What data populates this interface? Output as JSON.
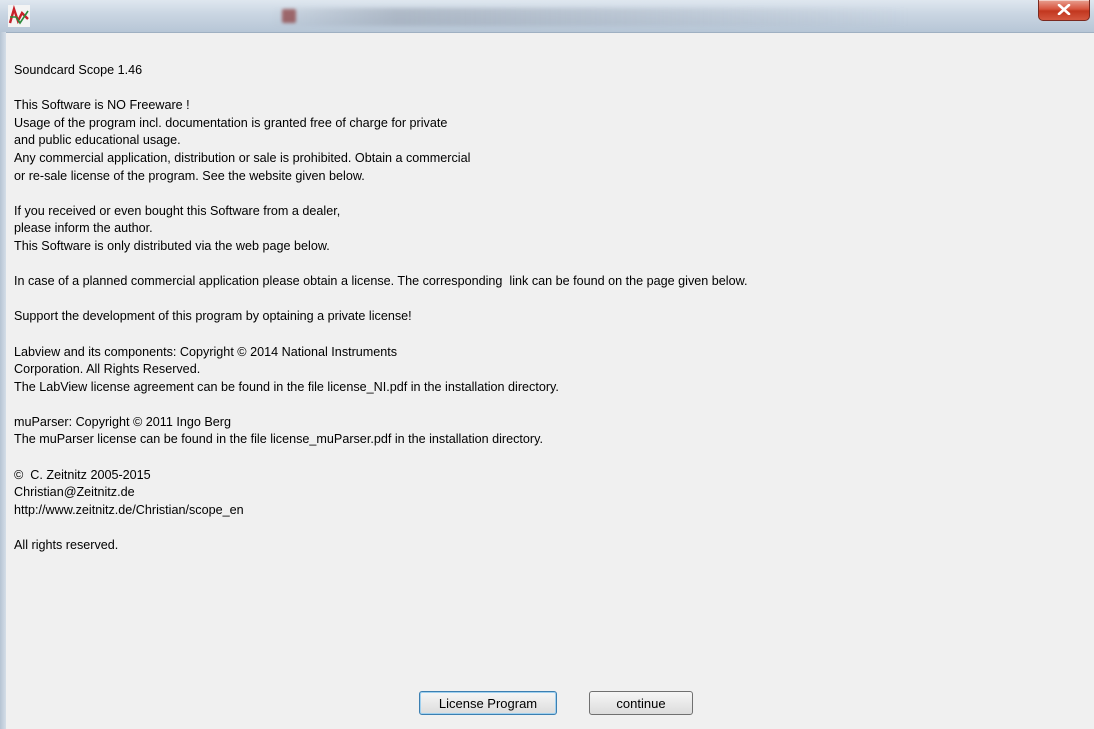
{
  "window": {
    "close_label": "x"
  },
  "message": {
    "paragraphs": [
      [
        "Soundcard Scope 1.46"
      ],
      [
        "This Software is NO Freeware !",
        "Usage of the program incl. documentation is granted free of charge for private",
        "and public educational usage.",
        "Any commercial application, distribution or sale is prohibited. Obtain a commercial",
        "or re-sale license of the program. See the website given below."
      ],
      [
        "If you received or even bought this Software from a dealer,",
        "please inform the author.",
        "This Software is only distributed via the web page below."
      ],
      [
        "In case of a planned commercial application please obtain a license. The corresponding  link can be found on the page given below."
      ],
      [
        "Support the development of this program by optaining a private license!"
      ],
      [
        "Labview and its components: Copyright © 2014 National Instruments",
        "Corporation. All Rights Reserved.",
        "The LabView license agreement can be found in the file license_NI.pdf in the installation directory."
      ],
      [
        "muParser: Copyright © 2011 Ingo Berg",
        "The muParser license can be found in the file license_muParser.pdf in the installation directory."
      ],
      [
        "©  C. Zeitnitz 2005-2015",
        "Christian@Zeitnitz.de",
        "http://www.zeitnitz.de/Christian/scope_en"
      ],
      [
        "All rights reserved."
      ]
    ]
  },
  "buttons": {
    "license_label": "License Program",
    "continue_label": "continue"
  }
}
